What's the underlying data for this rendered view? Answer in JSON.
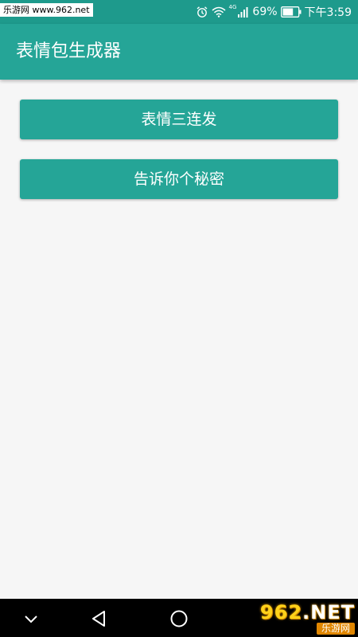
{
  "status_bar": {
    "watermark": "乐游网 www.962.net",
    "network_badge": "4G",
    "battery_percent": "69%",
    "time": "下午3:59",
    "battery_level": 0.69,
    "icons": [
      "alarm-icon",
      "wifi-icon",
      "signal-icon",
      "battery-icon"
    ]
  },
  "app_bar": {
    "title": "表情包生成器"
  },
  "main": {
    "buttons": [
      {
        "label": "表情三连发"
      },
      {
        "label": "告诉你个秘密"
      }
    ]
  },
  "nav_bar": {
    "icons": [
      "chevron-down-icon",
      "back-icon",
      "home-icon"
    ]
  },
  "watermark_bottom": {
    "logo_text_1": "962",
    "logo_text_2": ".NET",
    "subtitle": "乐游网"
  },
  "colors": {
    "primary": "#25a597",
    "status_bar": "#1e9a8c",
    "background": "#f6f6f6",
    "nav_bar": "#000000"
  }
}
